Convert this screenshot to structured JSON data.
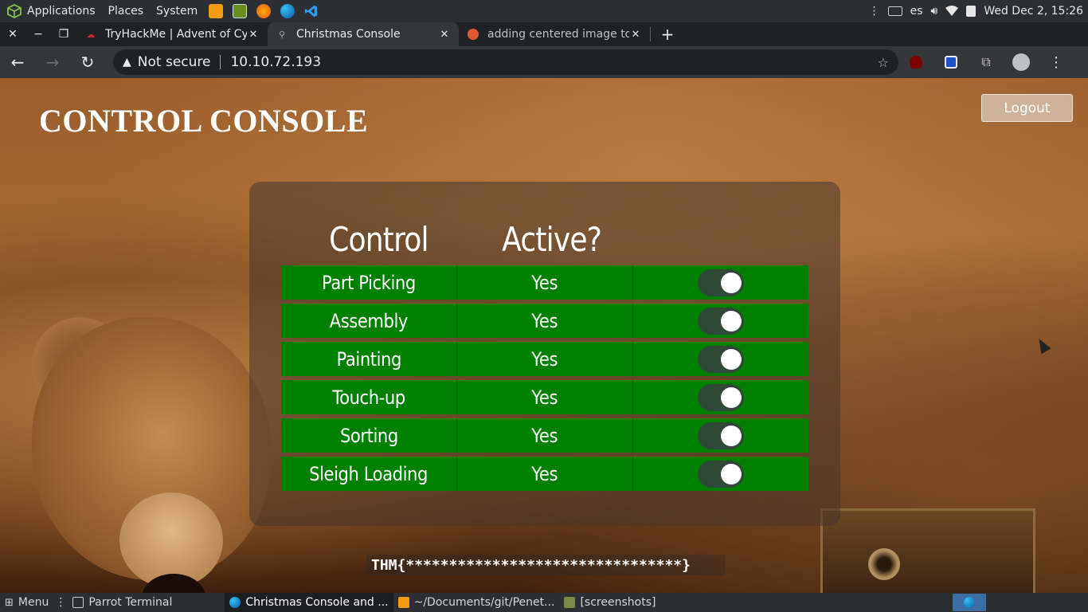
{
  "os_panel": {
    "menus": [
      "Applications",
      "Places",
      "System"
    ],
    "keyboard_layout": "es",
    "clock": "Wed Dec  2, 15:26"
  },
  "tabs": [
    {
      "title": "TryHackMe | Advent of Cy",
      "active": false
    },
    {
      "title": "Christmas Console",
      "active": true
    },
    {
      "title": "adding centered image to",
      "active": false
    }
  ],
  "address_bar": {
    "security": "Not secure",
    "url": "10.10.72.193"
  },
  "page": {
    "title": "CONTROL CONSOLE",
    "logout_label": "Logout",
    "headers": {
      "control": "Control",
      "active": "Active?"
    },
    "rows": [
      {
        "control": "Part Picking",
        "active": "Yes",
        "on": true
      },
      {
        "control": "Assembly",
        "active": "Yes",
        "on": true
      },
      {
        "control": "Painting",
        "active": "Yes",
        "on": true
      },
      {
        "control": "Touch-up",
        "active": "Yes",
        "on": true
      },
      {
        "control": "Sorting",
        "active": "Yes",
        "on": true
      },
      {
        "control": "Sleigh Loading",
        "active": "Yes",
        "on": true
      }
    ],
    "flag": "THM{********************************}"
  },
  "taskbar": {
    "menu_label": "Menu",
    "items": [
      {
        "label": "Parrot Terminal",
        "active": false
      },
      {
        "label": "Christmas Console and ...",
        "active": true
      },
      {
        "label": "~/Documents/git/Penet...",
        "active": false
      },
      {
        "label": "[screenshots]",
        "active": false
      }
    ]
  },
  "colors": {
    "row_green": "#008000",
    "toggle_track": "#2e4a36",
    "panel_bg": "#2b2e33"
  }
}
